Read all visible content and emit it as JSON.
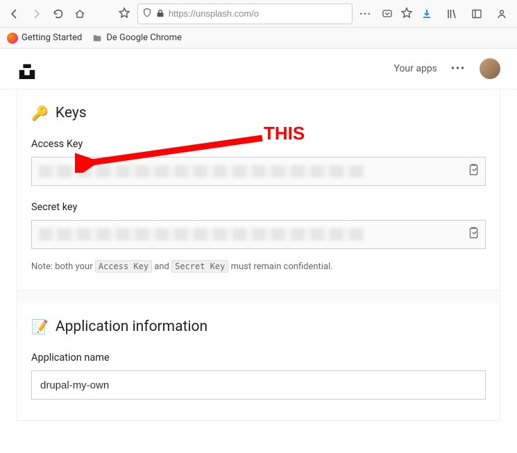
{
  "browser": {
    "url_display": "https://unsplash.com/o",
    "bookmarks": {
      "getting_started": "Getting Started",
      "chrome_folder": "De Google Chrome"
    }
  },
  "site_header": {
    "your_apps": "Your apps"
  },
  "annotation": {
    "label": "THIS"
  },
  "keys_section": {
    "title": "Keys",
    "access_key_label": "Access Key",
    "secret_key_label": "Secret key",
    "note_prefix": "Note: both your ",
    "note_code1": "Access Key",
    "note_mid": " and ",
    "note_code2": "Secret Key",
    "note_suffix": " must remain confidential."
  },
  "app_info_section": {
    "title": "Application information",
    "app_name_label": "Application name",
    "app_name_value": "drupal-my-own"
  }
}
